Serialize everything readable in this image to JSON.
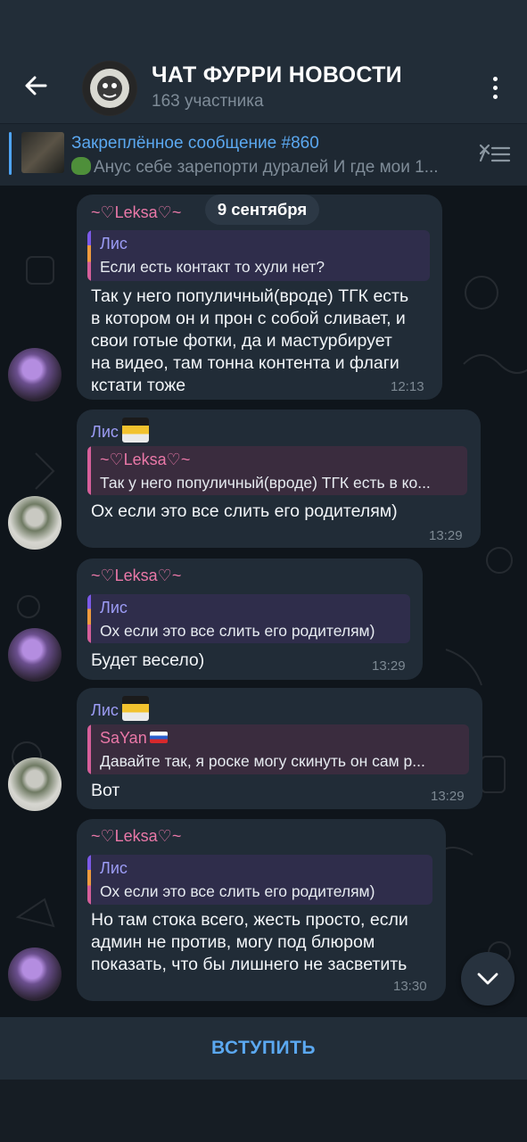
{
  "header": {
    "title": "ЧАТ ФУРРИ НОВОСТИ",
    "subtitle": "163 участника"
  },
  "pinned": {
    "title": "Закреплённое сообщение #860",
    "text": "Анус себе зарепорти дуралей  И где мои 1..."
  },
  "date_separator": "9 сентября",
  "messages": [
    {
      "sender": "~♡Leksa♡~",
      "reply_name": "Лис",
      "reply_text": "Если есть контакт то хули нет?",
      "lines": [
        "Так у него популичный(вроде) ТГК есть",
        "в котором он и прон с собой сливает, и",
        "свои готые фотки, да и мастурбирует",
        "на видео, там тонна контента и флаги",
        "кстати тоже"
      ],
      "time": "12:13"
    },
    {
      "sender": "Лис",
      "reply_name": "~♡Leksa♡~",
      "reply_text": "Так у него популичный(вроде) ТГК есть в ко...",
      "lines": [
        "Ох если это все слить его родителям)"
      ],
      "time": "13:29"
    },
    {
      "sender": "~♡Leksa♡~",
      "reply_name": "Лис",
      "reply_text": "Ох если это все слить его родителям)",
      "lines": [
        "Будет весело)"
      ],
      "time": "13:29"
    },
    {
      "sender": "Лис",
      "reply_name": "SaYan",
      "reply_text": "Давайте так, я роске могу скинуть он сам р...",
      "lines": [
        "Вот"
      ],
      "time": "13:29"
    },
    {
      "sender": "~♡Leksa♡~",
      "reply_name": "Лис",
      "reply_text": "Ох если это все слить его родителям)",
      "lines": [
        "Но там стока всего, жесть просто, если",
        "админ не против, могу под блюром",
        "показать, что бы лишнего не засветить"
      ],
      "time": "13:30"
    }
  ],
  "join_label": "ВСТУПИТЬ",
  "colors": {
    "accent": "#5ba8f0",
    "leksa_name": "#ea78a8",
    "lis_name": "#9c9cf5",
    "bubble": "#212c37",
    "header": "#222d38"
  },
  "icons": [
    "back-arrow-icon",
    "more-vert-icon",
    "pinned-list-icon",
    "chevron-down-icon"
  ]
}
